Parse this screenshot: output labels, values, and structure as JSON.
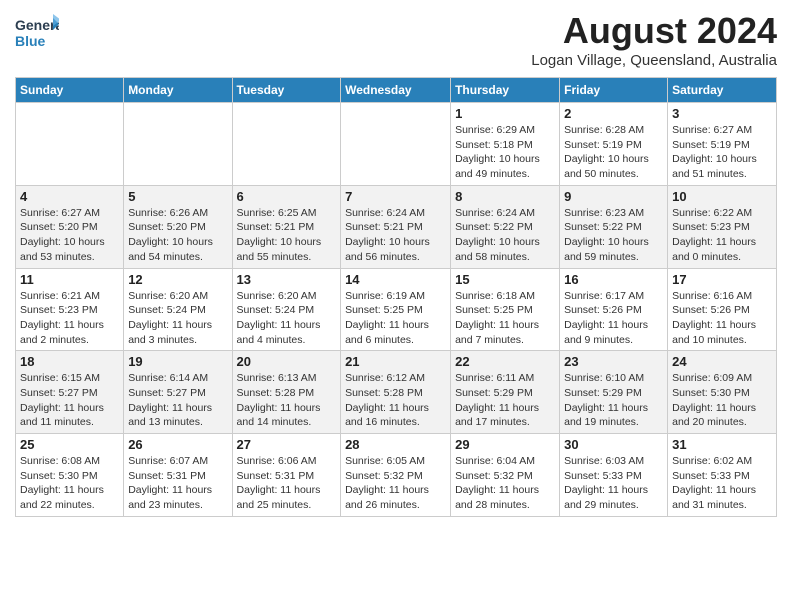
{
  "header": {
    "logo_line1": "General",
    "logo_line2": "Blue",
    "month_year": "August 2024",
    "location": "Logan Village, Queensland, Australia"
  },
  "weekdays": [
    "Sunday",
    "Monday",
    "Tuesday",
    "Wednesday",
    "Thursday",
    "Friday",
    "Saturday"
  ],
  "weeks": [
    [
      {
        "day": "",
        "info": ""
      },
      {
        "day": "",
        "info": ""
      },
      {
        "day": "",
        "info": ""
      },
      {
        "day": "",
        "info": ""
      },
      {
        "day": "1",
        "info": "Sunrise: 6:29 AM\nSunset: 5:18 PM\nDaylight: 10 hours\nand 49 minutes."
      },
      {
        "day": "2",
        "info": "Sunrise: 6:28 AM\nSunset: 5:19 PM\nDaylight: 10 hours\nand 50 minutes."
      },
      {
        "day": "3",
        "info": "Sunrise: 6:27 AM\nSunset: 5:19 PM\nDaylight: 10 hours\nand 51 minutes."
      }
    ],
    [
      {
        "day": "4",
        "info": "Sunrise: 6:27 AM\nSunset: 5:20 PM\nDaylight: 10 hours\nand 53 minutes."
      },
      {
        "day": "5",
        "info": "Sunrise: 6:26 AM\nSunset: 5:20 PM\nDaylight: 10 hours\nand 54 minutes."
      },
      {
        "day": "6",
        "info": "Sunrise: 6:25 AM\nSunset: 5:21 PM\nDaylight: 10 hours\nand 55 minutes."
      },
      {
        "day": "7",
        "info": "Sunrise: 6:24 AM\nSunset: 5:21 PM\nDaylight: 10 hours\nand 56 minutes."
      },
      {
        "day": "8",
        "info": "Sunrise: 6:24 AM\nSunset: 5:22 PM\nDaylight: 10 hours\nand 58 minutes."
      },
      {
        "day": "9",
        "info": "Sunrise: 6:23 AM\nSunset: 5:22 PM\nDaylight: 10 hours\nand 59 minutes."
      },
      {
        "day": "10",
        "info": "Sunrise: 6:22 AM\nSunset: 5:23 PM\nDaylight: 11 hours\nand 0 minutes."
      }
    ],
    [
      {
        "day": "11",
        "info": "Sunrise: 6:21 AM\nSunset: 5:23 PM\nDaylight: 11 hours\nand 2 minutes."
      },
      {
        "day": "12",
        "info": "Sunrise: 6:20 AM\nSunset: 5:24 PM\nDaylight: 11 hours\nand 3 minutes."
      },
      {
        "day": "13",
        "info": "Sunrise: 6:20 AM\nSunset: 5:24 PM\nDaylight: 11 hours\nand 4 minutes."
      },
      {
        "day": "14",
        "info": "Sunrise: 6:19 AM\nSunset: 5:25 PM\nDaylight: 11 hours\nand 6 minutes."
      },
      {
        "day": "15",
        "info": "Sunrise: 6:18 AM\nSunset: 5:25 PM\nDaylight: 11 hours\nand 7 minutes."
      },
      {
        "day": "16",
        "info": "Sunrise: 6:17 AM\nSunset: 5:26 PM\nDaylight: 11 hours\nand 9 minutes."
      },
      {
        "day": "17",
        "info": "Sunrise: 6:16 AM\nSunset: 5:26 PM\nDaylight: 11 hours\nand 10 minutes."
      }
    ],
    [
      {
        "day": "18",
        "info": "Sunrise: 6:15 AM\nSunset: 5:27 PM\nDaylight: 11 hours\nand 11 minutes."
      },
      {
        "day": "19",
        "info": "Sunrise: 6:14 AM\nSunset: 5:27 PM\nDaylight: 11 hours\nand 13 minutes."
      },
      {
        "day": "20",
        "info": "Sunrise: 6:13 AM\nSunset: 5:28 PM\nDaylight: 11 hours\nand 14 minutes."
      },
      {
        "day": "21",
        "info": "Sunrise: 6:12 AM\nSunset: 5:28 PM\nDaylight: 11 hours\nand 16 minutes."
      },
      {
        "day": "22",
        "info": "Sunrise: 6:11 AM\nSunset: 5:29 PM\nDaylight: 11 hours\nand 17 minutes."
      },
      {
        "day": "23",
        "info": "Sunrise: 6:10 AM\nSunset: 5:29 PM\nDaylight: 11 hours\nand 19 minutes."
      },
      {
        "day": "24",
        "info": "Sunrise: 6:09 AM\nSunset: 5:30 PM\nDaylight: 11 hours\nand 20 minutes."
      }
    ],
    [
      {
        "day": "25",
        "info": "Sunrise: 6:08 AM\nSunset: 5:30 PM\nDaylight: 11 hours\nand 22 minutes."
      },
      {
        "day": "26",
        "info": "Sunrise: 6:07 AM\nSunset: 5:31 PM\nDaylight: 11 hours\nand 23 minutes."
      },
      {
        "day": "27",
        "info": "Sunrise: 6:06 AM\nSunset: 5:31 PM\nDaylight: 11 hours\nand 25 minutes."
      },
      {
        "day": "28",
        "info": "Sunrise: 6:05 AM\nSunset: 5:32 PM\nDaylight: 11 hours\nand 26 minutes."
      },
      {
        "day": "29",
        "info": "Sunrise: 6:04 AM\nSunset: 5:32 PM\nDaylight: 11 hours\nand 28 minutes."
      },
      {
        "day": "30",
        "info": "Sunrise: 6:03 AM\nSunset: 5:33 PM\nDaylight: 11 hours\nand 29 minutes."
      },
      {
        "day": "31",
        "info": "Sunrise: 6:02 AM\nSunset: 5:33 PM\nDaylight: 11 hours\nand 31 minutes."
      }
    ]
  ],
  "alt_rows": [
    1,
    3
  ]
}
